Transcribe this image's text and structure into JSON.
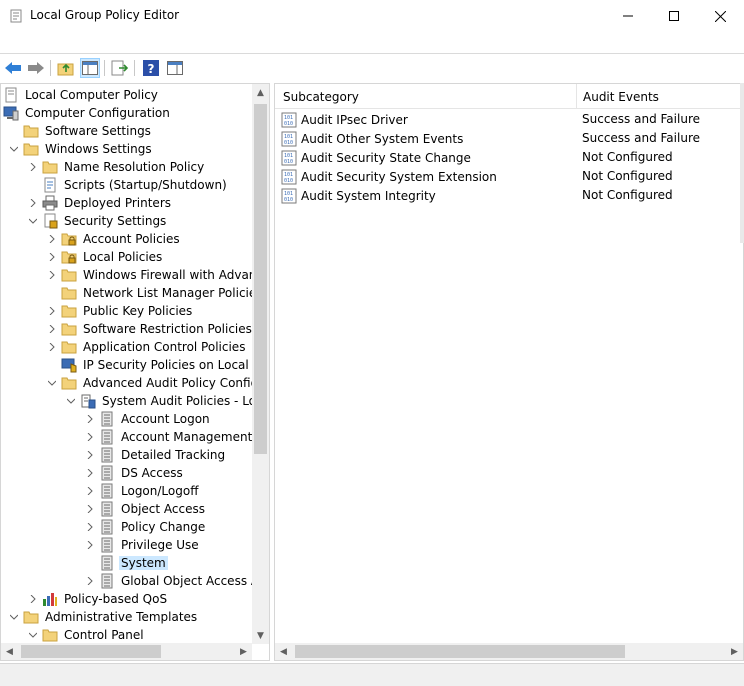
{
  "window": {
    "title": "Local Group Policy Editor"
  },
  "tree": {
    "items": [
      {
        "label": "Local Computer Policy",
        "level": 0,
        "chevron": "none",
        "icon": "policy-root-icon"
      },
      {
        "label": "Computer Configuration",
        "level": 0,
        "chevron": "none",
        "icon": "computer-icon"
      },
      {
        "label": "Software Settings",
        "level": 1,
        "chevron": "none",
        "icon": "folder-icon"
      },
      {
        "label": "Windows Settings",
        "level": 1,
        "chevron": "down",
        "icon": "folder-icon"
      },
      {
        "label": "Name Resolution Policy",
        "level": 2,
        "chevron": "right",
        "icon": "folder-icon"
      },
      {
        "label": "Scripts (Startup/Shutdown)",
        "level": 2,
        "chevron": "none",
        "icon": "script-icon"
      },
      {
        "label": "Deployed Printers",
        "level": 2,
        "chevron": "right",
        "icon": "printer-icon"
      },
      {
        "label": "Security Settings",
        "level": 2,
        "chevron": "down",
        "icon": "security-icon"
      },
      {
        "label": "Account Policies",
        "level": 3,
        "chevron": "right",
        "icon": "locked-folder-icon"
      },
      {
        "label": "Local Policies",
        "level": 3,
        "chevron": "right",
        "icon": "locked-folder-icon"
      },
      {
        "label": "Windows Firewall with Advance",
        "level": 3,
        "chevron": "right",
        "icon": "folder-icon"
      },
      {
        "label": "Network List Manager Policies",
        "level": 3,
        "chevron": "none",
        "icon": "folder-icon"
      },
      {
        "label": "Public Key Policies",
        "level": 3,
        "chevron": "right",
        "icon": "folder-icon"
      },
      {
        "label": "Software Restriction Policies",
        "level": 3,
        "chevron": "right",
        "icon": "folder-icon"
      },
      {
        "label": "Application Control Policies",
        "level": 3,
        "chevron": "right",
        "icon": "folder-icon"
      },
      {
        "label": "IP Security Policies on Local Co",
        "level": 3,
        "chevron": "none",
        "icon": "ipsec-icon"
      },
      {
        "label": "Advanced Audit Policy Configu",
        "level": 3,
        "chevron": "down",
        "icon": "folder-icon"
      },
      {
        "label": "System Audit Policies - Loc",
        "level": 4,
        "chevron": "down",
        "icon": "audit-policy-icon"
      },
      {
        "label": "Account Logon",
        "level": 5,
        "chevron": "right",
        "icon": "audit-category-icon"
      },
      {
        "label": "Account Management",
        "level": 5,
        "chevron": "right",
        "icon": "audit-category-icon"
      },
      {
        "label": "Detailed Tracking",
        "level": 5,
        "chevron": "right",
        "icon": "audit-category-icon"
      },
      {
        "label": "DS Access",
        "level": 5,
        "chevron": "right",
        "icon": "audit-category-icon"
      },
      {
        "label": "Logon/Logoff",
        "level": 5,
        "chevron": "right",
        "icon": "audit-category-icon"
      },
      {
        "label": "Object Access",
        "level": 5,
        "chevron": "right",
        "icon": "audit-category-icon"
      },
      {
        "label": "Policy Change",
        "level": 5,
        "chevron": "right",
        "icon": "audit-category-icon"
      },
      {
        "label": "Privilege Use",
        "level": 5,
        "chevron": "right",
        "icon": "audit-category-icon"
      },
      {
        "label": "System",
        "level": 5,
        "chevron": "none",
        "icon": "audit-category-icon",
        "selected": true
      },
      {
        "label": "Global Object Access Au",
        "level": 5,
        "chevron": "right",
        "icon": "audit-category-icon"
      },
      {
        "label": "Policy-based QoS",
        "level": 2,
        "chevron": "right",
        "icon": "qos-chart-icon"
      },
      {
        "label": "Administrative Templates",
        "level": 1,
        "chevron": "down",
        "icon": "folder-icon"
      },
      {
        "label": "Control Panel",
        "level": 2,
        "chevron": "down",
        "icon": "folder-icon"
      }
    ]
  },
  "list": {
    "columns": [
      "Subcategory",
      "Audit Events"
    ],
    "rows": [
      {
        "subcategory": "Audit IPsec Driver",
        "events": "Success and Failure"
      },
      {
        "subcategory": "Audit Other System Events",
        "events": "Success and Failure"
      },
      {
        "subcategory": "Audit Security State Change",
        "events": "Not Configured"
      },
      {
        "subcategory": "Audit Security System Extension",
        "events": "Not Configured"
      },
      {
        "subcategory": "Audit System Integrity",
        "events": "Not Configured"
      }
    ]
  },
  "colors": {
    "selection": "#cce8ff",
    "folder": "#f3d27a",
    "back_arrow": "#2f7fd6",
    "help": "#2b4fa8"
  }
}
